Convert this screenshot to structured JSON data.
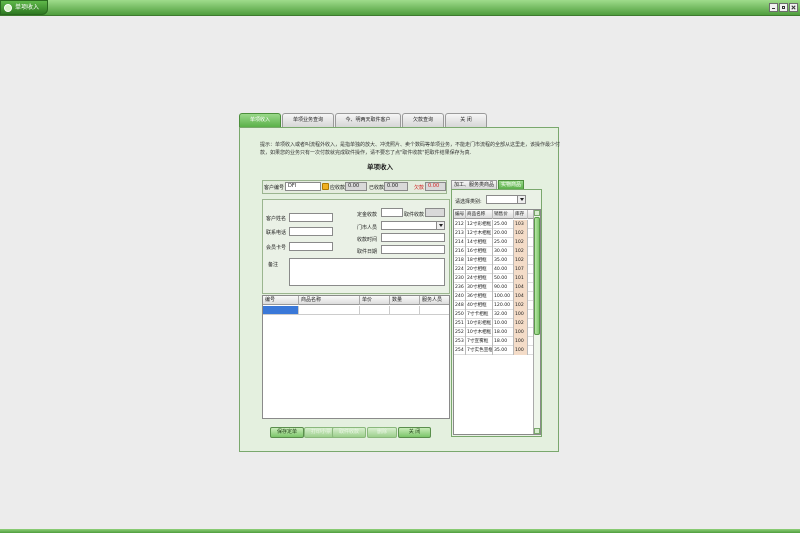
{
  "window": {
    "title": "单项收入"
  },
  "tabs": [
    {
      "label": "单项收入"
    },
    {
      "label": "单项业务查询"
    },
    {
      "label": "今、明两天取件客户"
    },
    {
      "label": "欠款查询"
    },
    {
      "label": "关 闭"
    }
  ],
  "hint": "提示：单项收入或者叫流程外收入，是指单独的放大、冲洗照片、卖个数码等单项业务，不能走门市流程的全部从这里走，该操作最少付款，如果您的业务只有一次付款就完成取件操作，请不要忘了点\"取件收款\"把取件结果保存为真.",
  "form_title": "单项收入",
  "info": {
    "customer_no_label": "客户编号",
    "customer_no": "DFI",
    "receivable_label": "应收款",
    "receivable": "0.00",
    "received_label": "已收款",
    "received": "0.00",
    "owed_label": "欠款",
    "owed": "0.00"
  },
  "customer": {
    "name_label": "客户姓名",
    "phone_label": "联系电话",
    "member_label": "会员卡号",
    "deposit_label": "定金收款",
    "pickup_pay_label": "取件收款",
    "staff_label": "门市人员",
    "collect_time_label": "收款时间",
    "pickup_date_label": "取件日期",
    "remark_label": "备注"
  },
  "items_grid": {
    "headers": [
      "编号",
      "商品名称",
      "单价",
      "数量",
      "服务人员"
    ]
  },
  "buttons": {
    "save": "保存定单",
    "print": "打印小票",
    "pickup": "取件收款",
    "delete": "删除",
    "close": "关 闭"
  },
  "product_panel": {
    "tabs": [
      "加工、服务类商品",
      "实物商品"
    ],
    "category_label": "请选择类别:",
    "headers": [
      "编号",
      "商品名称",
      "销售价",
      "库存"
    ],
    "rows": [
      [
        "212",
        "12寸彩相框",
        "25.00",
        "103"
      ],
      [
        "213",
        "12寸木相框",
        "20.00",
        "102"
      ],
      [
        "214",
        "14寸相框",
        "25.00",
        "102"
      ],
      [
        "216",
        "16寸相框",
        "30.00",
        "102"
      ],
      [
        "218",
        "18寸相框",
        "35.00",
        "102"
      ],
      [
        "224",
        "20寸相框",
        "40.00",
        "107"
      ],
      [
        "230",
        "24寸相框",
        "50.00",
        "101"
      ],
      [
        "236",
        "30寸相框",
        "90.00",
        "104"
      ],
      [
        "240",
        "36寸相框",
        "100.00",
        "104"
      ],
      [
        "248",
        "40寸相框",
        "120.00",
        "102"
      ],
      [
        "250",
        "7寸卡相框",
        "32.00",
        "100"
      ],
      [
        "251",
        "10寸彩相框",
        "10.00",
        "102"
      ],
      [
        "252",
        "10寸木相框",
        "18.00",
        "100"
      ],
      [
        "253",
        "7寸宣雾框",
        "18.00",
        "100"
      ],
      [
        "254",
        "7寸实色宣框",
        "35.00",
        "100"
      ]
    ]
  }
}
